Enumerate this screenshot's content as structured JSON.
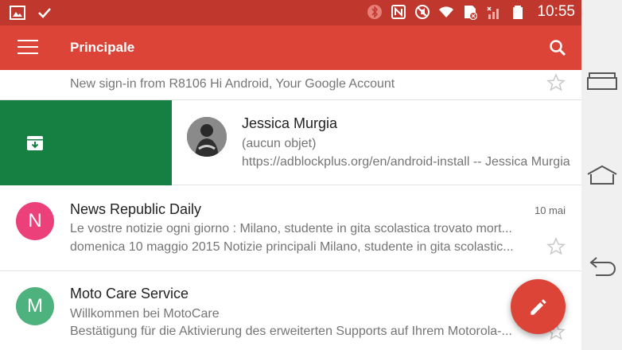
{
  "status_bar": {
    "time": "10:55",
    "icons": [
      "image-icon",
      "check-icon",
      "bluetooth-icon",
      "nfc-icon",
      "mute-icon",
      "wifi-icon",
      "sim-icon",
      "signal-icon",
      "battery-icon"
    ]
  },
  "app_bar": {
    "title": "Principale"
  },
  "emails": [
    {
      "preview": "New sign-in from R8106 Hi Android, Your Google Account"
    },
    {
      "sender": "Jessica Murgia",
      "subject": "(aucun objet)",
      "preview": "https://adblockplus.org/en/android-install -- Jessica Murgia"
    },
    {
      "avatar_letter": "N",
      "avatar_color": "#ec407a",
      "sender": "News Republic Daily",
      "date": "10 mai",
      "subject": "Le vostre notizie ogni giorno : Milano, studente in gita scolastica trovato mort...",
      "preview": "domenica 10 maggio 2015 Notizie principali Milano, studente in gita scolastic..."
    },
    {
      "avatar_letter": "M",
      "avatar_color": "#4db27d",
      "sender": "Moto Care Service",
      "subject": "Willkommen bei MotoCare",
      "preview": "Bestätigung für die Aktivierung des erweiterten Supports auf Ihrem Motorola-..."
    }
  ],
  "colors": {
    "status_bar": "#c0382d",
    "app_bar": "#db4437",
    "archive": "#168043",
    "fab": "#db4437"
  },
  "fab": {
    "icon": "pencil-icon"
  },
  "nav_bar": {
    "buttons": [
      "recent-apps-icon",
      "home-icon",
      "back-icon"
    ]
  }
}
